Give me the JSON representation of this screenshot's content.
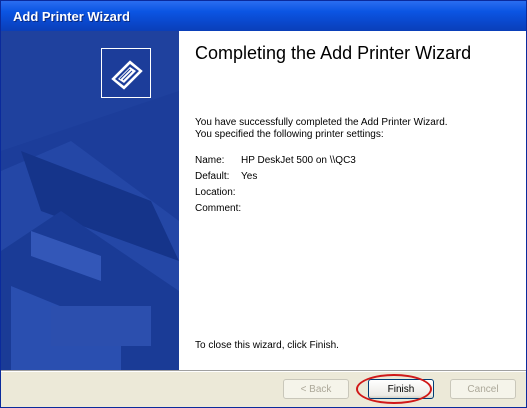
{
  "window": {
    "title": "Add Printer Wizard"
  },
  "main": {
    "heading": "Completing the Add Printer Wizard",
    "intro_line1": "You have successfully completed the Add Printer Wizard.",
    "intro_line2": "You specified the following printer settings:",
    "settings": [
      {
        "label": "Name:",
        "value": "HP DeskJet 500 on \\\\QC3"
      },
      {
        "label": "Default:",
        "value": "Yes"
      },
      {
        "label": "Location:",
        "value": ""
      },
      {
        "label": "Comment:",
        "value": ""
      }
    ],
    "close_hint": "To close this wizard, click Finish."
  },
  "buttons": {
    "back": "< Back",
    "finish": "Finish",
    "cancel": "Cancel"
  },
  "colors": {
    "titlebar": "#0b55e3",
    "banner": "#1c3d9a",
    "button_face": "#ece9d8",
    "highlight": "#d01818"
  },
  "icons": {
    "banner": "printer-wizard-icon"
  }
}
